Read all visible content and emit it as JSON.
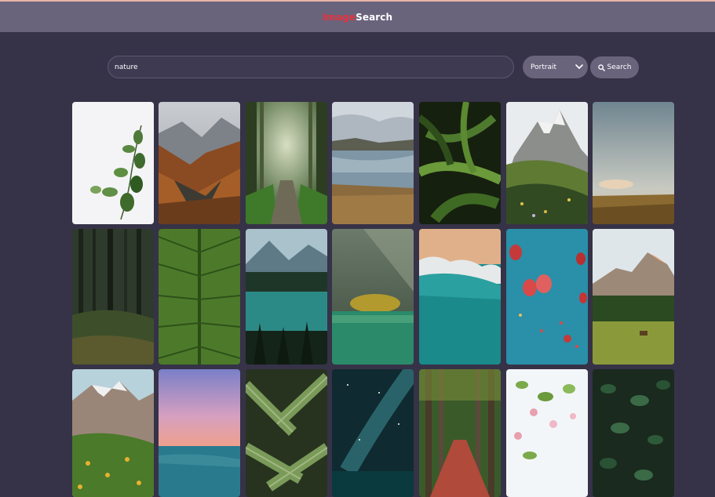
{
  "header": {
    "logo_part1": "Image",
    "logo_part2": "Search"
  },
  "search": {
    "value": "nature"
  },
  "orientation_select": {
    "selected": "Portrait"
  },
  "search_button": {
    "label": "Search",
    "icon": "search-icon"
  },
  "colors": {
    "accent": "#e8323c",
    "background": "#363247",
    "navbar": "#6a637c",
    "top_border": "#e8b4a6"
  },
  "gallery": {
    "rows": 3,
    "columns": 7,
    "images": [
      {
        "subject": "plant-branch"
      },
      {
        "subject": "autumn-mountain-forest"
      },
      {
        "subject": "misty-forest-path"
      },
      {
        "subject": "lake-reflection-grass"
      },
      {
        "subject": "ferns"
      },
      {
        "subject": "mountain-peaks-flowers"
      },
      {
        "subject": "sky-grass-field"
      },
      {
        "subject": "dark-forest"
      },
      {
        "subject": "green-leaf-closeup"
      },
      {
        "subject": "mountain-lake-pines"
      },
      {
        "subject": "sunlit-lake-island"
      },
      {
        "subject": "aerial-beach-waves"
      },
      {
        "subject": "hot-air-balloons"
      },
      {
        "subject": "yosemite-meadow-deer"
      },
      {
        "subject": "mountain-flower-meadow"
      },
      {
        "subject": "sunset-ocean"
      },
      {
        "subject": "palm-leaves"
      },
      {
        "subject": "milky-way-sea"
      },
      {
        "subject": "tree-lined-path"
      },
      {
        "subject": "blossom-branch"
      },
      {
        "subject": "dark-leaves"
      }
    ]
  }
}
